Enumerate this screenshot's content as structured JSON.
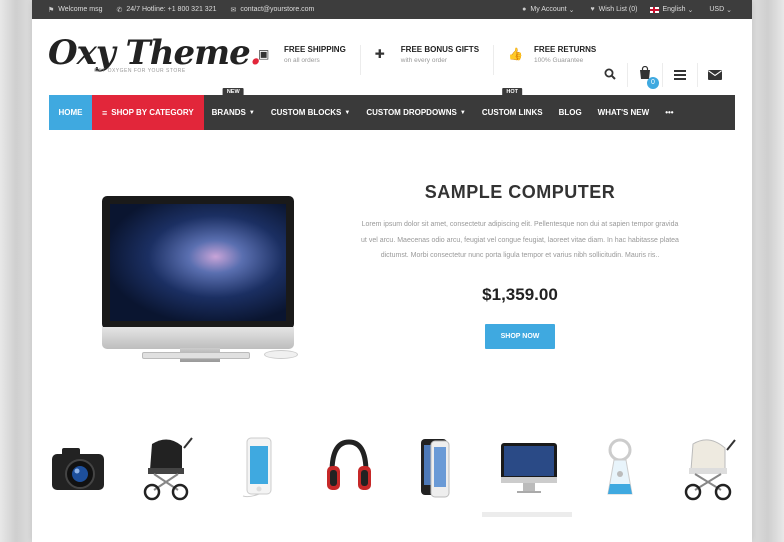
{
  "topbar": {
    "welcome": "Welcome msg",
    "hotline": "24/7 Hotline: +1 800 321 321",
    "email": "contact@yourstore.com",
    "my_account": "My Account",
    "wishlist": "Wish List (0)",
    "language": "English",
    "currency": "USD"
  },
  "header": {
    "logo": "Oxy Theme",
    "logo_dot": ".",
    "tagline": "GET OXYGEN FOR YOUR STORE",
    "features": [
      {
        "title": "FREE SHIPPING",
        "sub": "on all orders",
        "icon": "box-icon"
      },
      {
        "title": "FREE BONUS GIFTS",
        "sub": "with every order",
        "icon": "gift-icon"
      },
      {
        "title": "FREE RETURNS",
        "sub": "100% Guarantee",
        "icon": "thumbs-up-icon"
      }
    ],
    "cart_count": "0"
  },
  "nav": {
    "home": "HOME",
    "shop_by_category": "SHOP BY CATEGORY",
    "brands": "BRANDS",
    "brands_tag": "NEW",
    "custom_blocks": "CUSTOM BLOCKS",
    "custom_dropdowns": "CUSTOM DROPDOWNS",
    "custom_links": "CUSTOM LINKS",
    "custom_links_tag": "HOT",
    "blog": "BLOG",
    "whats_new": "WHAT'S NEW",
    "more": "•••"
  },
  "slide": {
    "title": "SAMPLE COMPUTER",
    "description": "Lorem ipsum dolor sit amet, consectetur adipiscing elit. Pellentesque non dui at sapien tempor gravida ut vel arcu. Maecenas odio arcu, feugiat vel congue feugiat, laoreet vitae diam. In hac habitasse platea dictumst. Morbi consectetur nunc porta ligula tempor et varius nibh sollicitudin. Mauris ris..",
    "price": "$1,359.00",
    "button": "SHOP NOW"
  },
  "thumbnails": [
    "camera",
    "stroller",
    "ipod",
    "headphones",
    "iphone",
    "imac",
    "baby-monitor",
    "pram"
  ],
  "colors": {
    "accent": "#3fa9e0",
    "brand_red": "#e2263a",
    "nav_bg": "#3a3a3a"
  }
}
